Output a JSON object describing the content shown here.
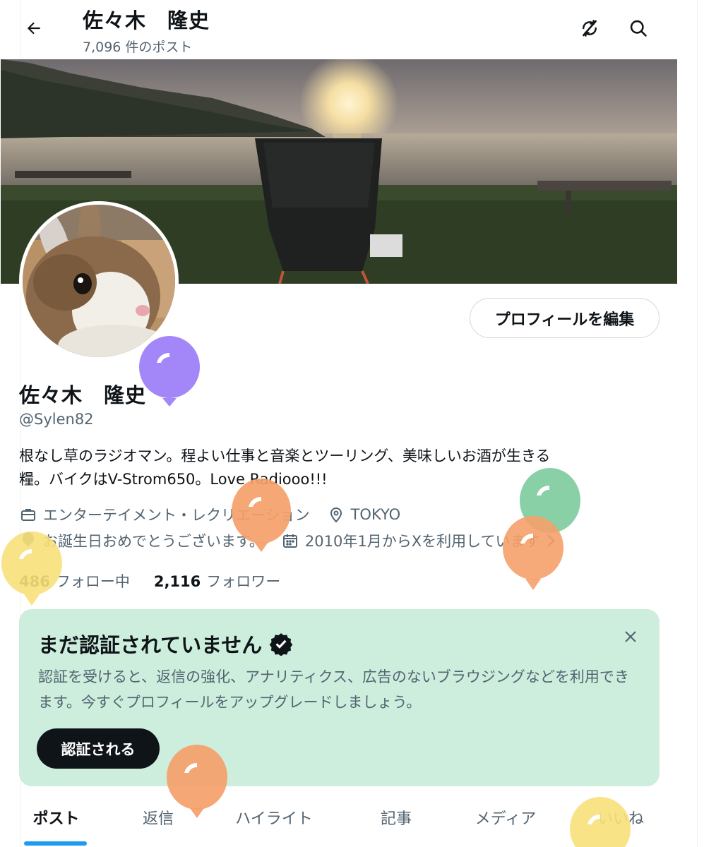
{
  "header": {
    "title": "佐々木　隆史",
    "post_count": "7,096 件のポスト"
  },
  "profile": {
    "edit_button": "プロフィールを編集",
    "name": "佐々木　隆史",
    "handle": "@Sylen82",
    "bio_line1": "根なし草のラジオマン。程よい仕事と音楽とツーリング、美味しいお酒が生きる",
    "bio_line2": "糧。バイクはV-Strom650。Love Radiooo!!!",
    "category": "エンターテイメント・レクリエーション",
    "location": "TOKYO",
    "birthday": "お誕生日おめでとうございます。",
    "joined": "2010年1月からXを利用しています",
    "following_count": "486",
    "following_label": "フォロー中",
    "followers_count": "2,116",
    "followers_label": "フォロワー"
  },
  "verify_card": {
    "title": "まだ認証されていません",
    "text": "認証を受けると、返信の強化、アナリティクス、広告のないブラウジングなどを利用できます。今すぐプロフィールをアップグレードしましょう。",
    "button": "認証される"
  },
  "tabs": [
    "ポスト",
    "返信",
    "ハイライト",
    "記事",
    "メディア",
    "いいね"
  ],
  "colors": {
    "accent": "#1d9bf0",
    "card_bg": "#cdeedd",
    "balloon_purple": "#9b7cf7",
    "balloon_orange": "#f5a06a",
    "balloon_yellow": "#f8e07a",
    "balloon_green": "#7fcc9e"
  },
  "icons": [
    "back-arrow-icon",
    "sync-off-icon",
    "search-icon",
    "briefcase-icon",
    "location-pin-icon",
    "balloon-icon",
    "calendar-icon",
    "chevron-right-icon",
    "verified-badge-icon",
    "close-icon"
  ]
}
